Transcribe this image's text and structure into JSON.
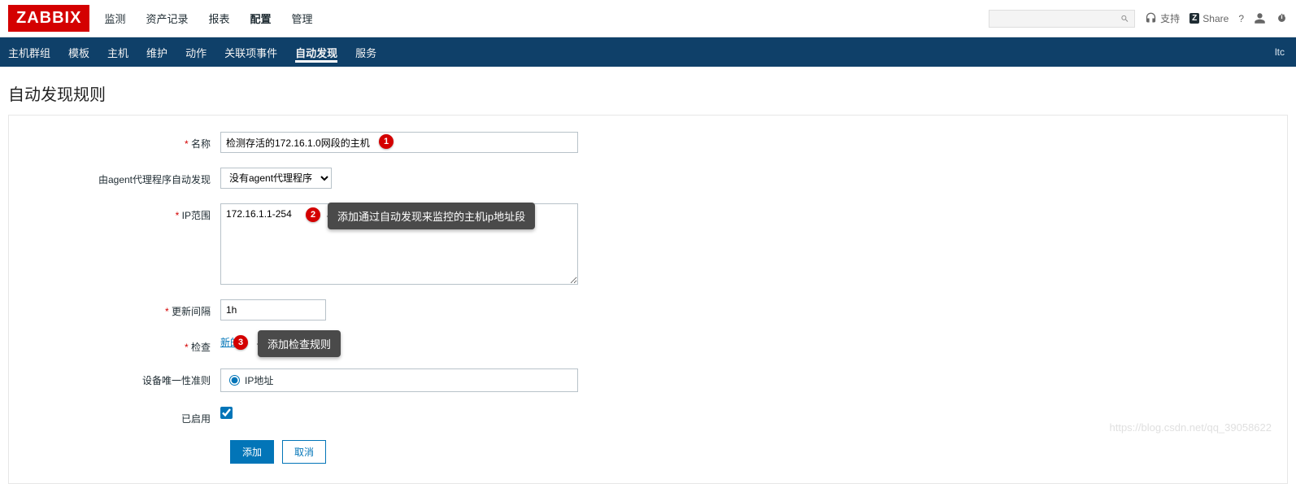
{
  "brand": "ZABBIX",
  "topnav": {
    "items": [
      "监测",
      "资产记录",
      "报表",
      "配置",
      "管理"
    ],
    "active_index": 3,
    "support": "支持",
    "share": "Share",
    "help": "?"
  },
  "search": {
    "placeholder": ""
  },
  "subnav": {
    "items": [
      "主机群组",
      "模板",
      "主机",
      "维护",
      "动作",
      "关联项事件",
      "自动发现",
      "服务"
    ],
    "active_index": 6,
    "right": "ltc"
  },
  "page": {
    "title": "自动发现规则"
  },
  "form": {
    "name": {
      "label": "名称",
      "value": "检测存活的172.16.1.0网段的主机"
    },
    "proxy": {
      "label": "由agent代理程序自动发现",
      "selected": "没有agent代理程序"
    },
    "ip_range": {
      "label": "IP范围",
      "value": "172.16.1.1-254"
    },
    "interval": {
      "label": "更新间隔",
      "value": "1h"
    },
    "checks": {
      "label": "检查",
      "link": "新的"
    },
    "uniqueness": {
      "label": "设备唯一性准则",
      "option": "IP地址"
    },
    "enabled": {
      "label": "已启用",
      "checked": true
    },
    "buttons": {
      "add": "添加",
      "cancel": "取消"
    }
  },
  "callouts": {
    "c1": "1",
    "c2": "2",
    "c2_tip": "添加通过自动发现来监控的主机ip地址段",
    "c3": "3",
    "c3_tip": "添加检查规则"
  },
  "watermark": "https://blog.csdn.net/qq_39058622"
}
